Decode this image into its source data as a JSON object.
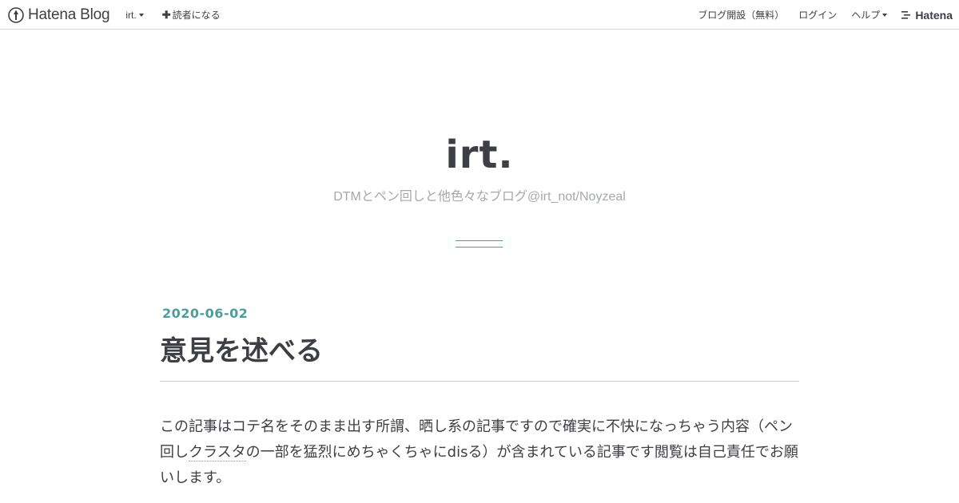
{
  "topbar": {
    "logo_text": "Hatena Blog",
    "blog_menu_label": "irt.",
    "subscribe_label": "読者になる",
    "open_blog_label": "ブログ開設（無料）",
    "login_label": "ログイン",
    "help_label": "ヘルプ",
    "hatena_label": "Hatena"
  },
  "header": {
    "title": "irt.",
    "description": "DTMとペン回しと他色々なブログ@irt_not/Noyzeal"
  },
  "entry": {
    "date": "2020-06-02",
    "title": "意見を述べる",
    "body_part1": "この記事はコテ名をそのまま出す所謂、晒し系の記事ですので確実に不快になっちゃう内容（ペン回し",
    "body_keyword": "クラスタ",
    "body_part2": "の一部を猛烈にめちゃくちゃにdisる）が含まれている記事です閲覧は自己責任でお願いします。"
  },
  "colors": {
    "accent": "#4d9e9b",
    "text": "#3d3f44",
    "muted": "#a4a8ad",
    "border": "#d5d5d5"
  },
  "icons": {
    "logo": "hatena-blog-pen-icon",
    "hatena": "hatena-lines-icon"
  }
}
